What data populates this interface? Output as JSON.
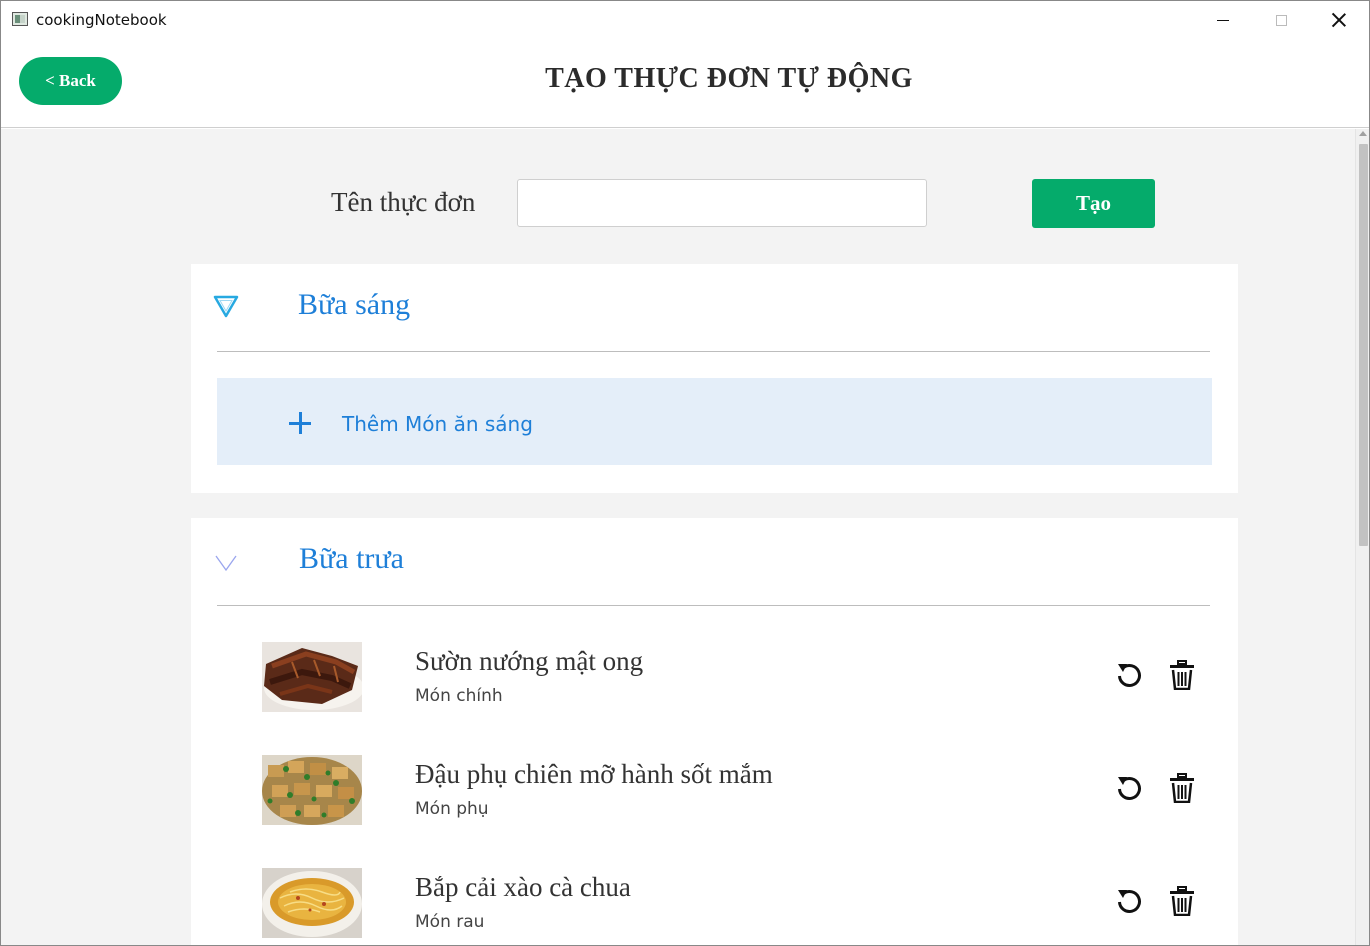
{
  "window": {
    "title": "cookingNotebook"
  },
  "header": {
    "back_label": "< Back",
    "title": "TẠO THỰC ĐƠN TỰ ĐỘNG"
  },
  "form": {
    "name_label": "Tên thực đơn",
    "name_value": "",
    "create_label": "Tạo"
  },
  "meals": [
    {
      "title": "Bữa sáng",
      "add_label": "Thêm Món ăn sáng"
    },
    {
      "title": "Bữa trưa",
      "dishes": [
        {
          "name": "Sườn nướng mật ong",
          "category": "Món chính",
          "image": "grilled-ribs-photo"
        },
        {
          "name": "Đậu phụ chiên mỡ hành sốt mắm",
          "category": "Món phụ",
          "image": "fried-tofu-photo"
        },
        {
          "name": "Bắp cải xào cà chua",
          "category": "Món rau",
          "image": "stir-fried-cabbage-photo"
        }
      ]
    }
  ],
  "colors": {
    "accent_green": "#05ab6b",
    "accent_blue": "#1e7fd8",
    "add_row_bg": "#e4eef9",
    "content_bg": "#f3f3f3"
  }
}
